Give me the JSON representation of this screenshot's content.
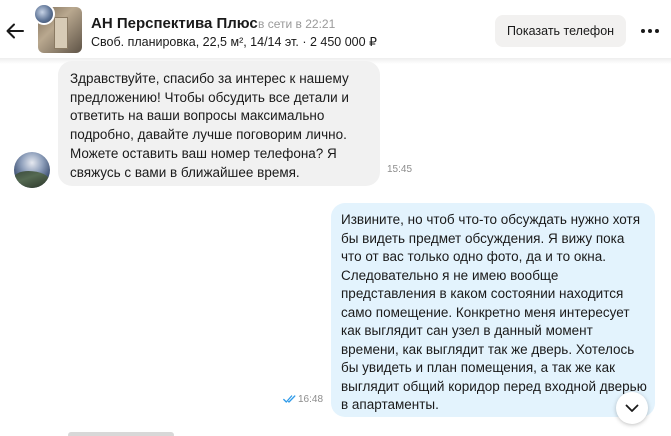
{
  "header": {
    "seller_name": "АН Перспектива Плюс",
    "seller_status": "в сети в 22:21",
    "listing_info": "Своб. планировка, 22,5 м², 14/14 эт. · 2 450 000 ₽",
    "show_phone_label": "Показать телефон",
    "icons": {
      "back": "arrow-left-icon",
      "more": "more-dots-icon"
    }
  },
  "messages": [
    {
      "direction": "incoming",
      "text": "Здравствуйте, спасибо за интерес к нашему предложению! Чтобы обсудить все детали и ответить на ваши вопросы максимально подробно, давайте лучше поговорим лично. Можете оставить ваш номер телефона? Я свяжусь с вами в ближайшее время.",
      "time": "15:45"
    },
    {
      "direction": "outgoing",
      "text": "Извините, но чтоб что-то обсуждать нужно хотя бы видеть предмет обсуждения. Я вижу пока что от вас только одно фото, да и то окна. Следовательно я не имею вообще представления в каком состоянии находится само помещение. Конкретно меня интересует как выглядит сан узел в данный момент времени, как выглядит так же дверь. Хотелось бы увидеть и план помещения, а так же как выглядит общий коридор перед входной дверью в апартаменты.",
      "time": "16:48",
      "status_icon": "double-check-icon"
    }
  ],
  "colors": {
    "incoming_bubble": "#f1f1f1",
    "outgoing_bubble": "#e3f3fd",
    "read_check": "#2f9be9",
    "muted_text": "#8d8d8d"
  }
}
